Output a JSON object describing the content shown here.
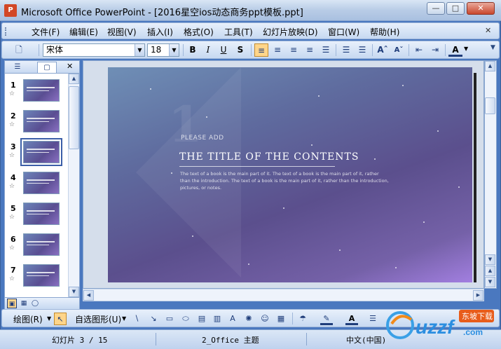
{
  "window": {
    "title": "Microsoft Office PowerPoint - [2016星空ios动态商务ppt模板.ppt]",
    "icon": "powerpoint-icon"
  },
  "menu": [
    "文件(F)",
    "编辑(E)",
    "视图(V)",
    "插入(I)",
    "格式(O)",
    "工具(T)",
    "幻灯片放映(D)",
    "窗口(W)",
    "帮助(H)"
  ],
  "toolbar": {
    "font": "宋体",
    "size": "18",
    "bold": "B",
    "italic": "I",
    "underline": "U",
    "shadow": "S",
    "font_color": "A"
  },
  "slides": [
    {
      "n": "1"
    },
    {
      "n": "2"
    },
    {
      "n": "3"
    },
    {
      "n": "4"
    },
    {
      "n": "5"
    },
    {
      "n": "6"
    },
    {
      "n": "7"
    }
  ],
  "selected_slide": 3,
  "slide": {
    "number": "1",
    "please_add": "PLEASE ADD",
    "title": "THE TITLE OF THE CONTENTS",
    "body": "The text of a book is the main part of it. The text of a book is the main part of it, rather than the introduction. The text of a book is the main part of it, rather than the introduction, pictures, or notes."
  },
  "drawbar": {
    "draw": "绘图(R)",
    "autoshapes": "自选图形(U)"
  },
  "status": {
    "slide": "幻灯片 3 / 15",
    "theme": "2_Office 主题",
    "lang": "中文(中国)"
  },
  "watermark": {
    "text": "uzzf",
    "cn": "东坡下载",
    "com": ".com"
  },
  "colors": {
    "accent": "#4a78bf",
    "bar": "#c7d9f1"
  }
}
